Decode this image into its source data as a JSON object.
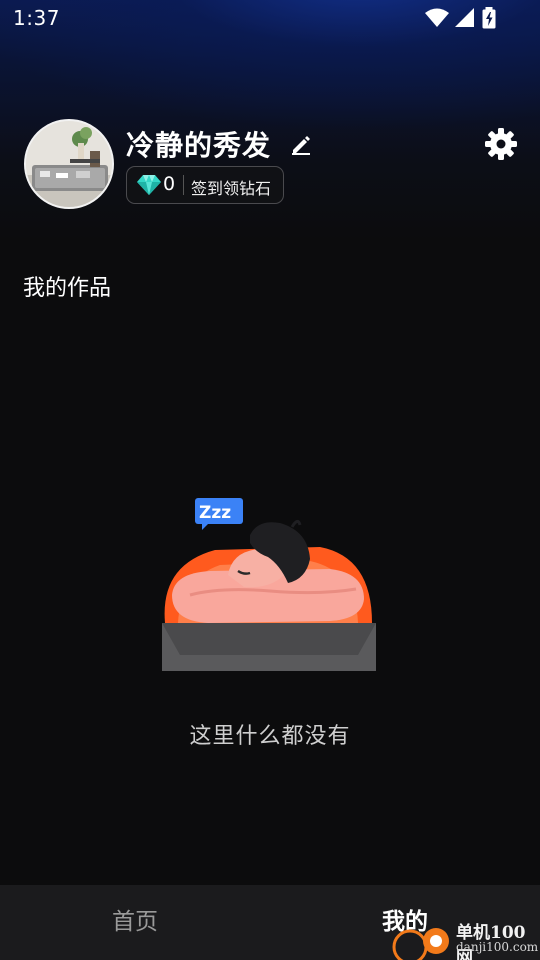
{
  "status_bar": {
    "time": "1:37",
    "icons": [
      "wifi-icon",
      "cell-signal-icon",
      "battery-charging-icon"
    ]
  },
  "profile": {
    "username": "冷静的秀发",
    "diamond_count": "0",
    "checkin_label": "签到领钻石",
    "edit_icon": "pencil-icon",
    "settings_icon": "gear-icon",
    "diamond_icon": "diamond-icon"
  },
  "works": {
    "title": "我的作品",
    "empty_text": "这里什么都没有",
    "empty_bubble": "Zzz"
  },
  "bottom_nav": {
    "home_label": "首页",
    "mine_label": "我的",
    "active": "我的"
  },
  "watermark": {
    "name": "单机100网",
    "url": "danji100.com"
  },
  "colors": {
    "background": "#0c0c0d",
    "header_gradient": "#0b1a4f",
    "diamond": "#3fe0d0",
    "pillow": "#ff5a1e",
    "nav_bg": "#1b1b1d",
    "bubble": "#3b82f6"
  }
}
